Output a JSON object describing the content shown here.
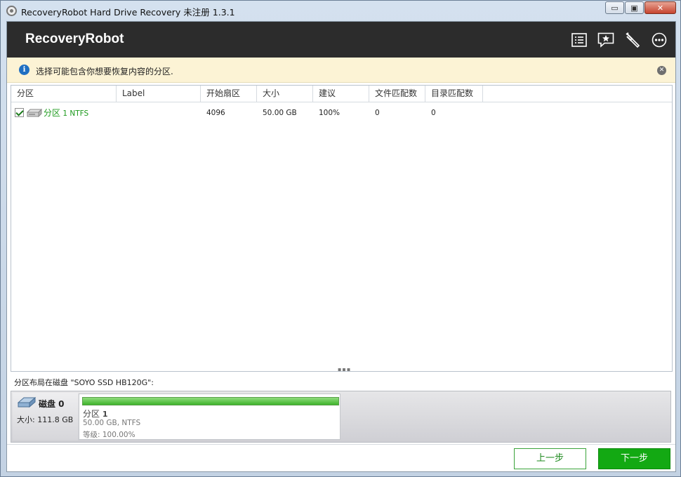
{
  "window": {
    "title": "RecoveryRobot Hard Drive Recovery 未注册 1.3.1",
    "minimize_glyph": "▭",
    "maximize_glyph": "▣",
    "close_glyph": "✕"
  },
  "header": {
    "brand": "RecoveryRobot",
    "icons": [
      "list-icon",
      "star-message-icon",
      "tools-icon",
      "more-icon"
    ]
  },
  "infobar": {
    "icon": "info-icon",
    "icon_glyph": "i",
    "message": "选择可能包含你想要恢复内容的分区.",
    "close_glyph": "✕"
  },
  "table": {
    "columns": [
      "分区",
      "Label",
      "开始扇区",
      "大小",
      "建议",
      "文件匹配数",
      "目录匹配数"
    ],
    "rows": [
      {
        "checked": true,
        "name": "分区",
        "detail": " 1 NTFS",
        "label": "",
        "start_sector": "4096",
        "size": "50.00 GB",
        "suggestion": "100%",
        "file_matches": "0",
        "dir_matches": "0"
      }
    ],
    "splitter": "▪▪▪"
  },
  "layout": {
    "label_prefix": "分区布局在磁盘 ",
    "disk_quoted": "\"SOYO SSD HB120G\":",
    "disk_name": "磁盘  0",
    "disk_size": "大小: 111.8 GB",
    "partition": {
      "title": "分区",
      "number": "1",
      "size_fs": "50.00 GB, NTFS",
      "level": "等级: 100.00%",
      "fill_fraction": 1.0
    }
  },
  "buttons": {
    "prev": "上一步",
    "next": "下一步"
  },
  "colors": {
    "header_bg": "#2c2c2c",
    "info_bg": "#fcf3d5",
    "accent_green": "#13a913",
    "partition_green": "#1d9a1d"
  }
}
